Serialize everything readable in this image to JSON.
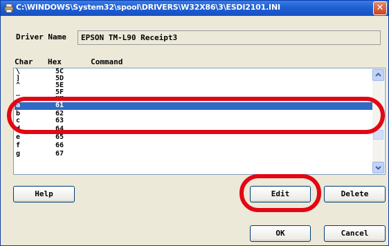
{
  "window": {
    "title": "C:\\WINDOWS\\System32\\spool\\DRIVERS\\W32X86\\3\\ESDI2101.INI",
    "close_glyph": "✕"
  },
  "driver": {
    "label": "Driver Name",
    "value": "EPSON TM-L90 Receipt3"
  },
  "table": {
    "headers": {
      "char": "Char",
      "hex": "Hex",
      "command": "Command"
    },
    "rows": [
      {
        "char": "\\",
        "hex": "5C"
      },
      {
        "char": "]",
        "hex": "5D"
      },
      {
        "char": "^",
        "hex": "5E"
      },
      {
        "char": "_",
        "hex": "5F"
      },
      {
        "char": "`",
        "hex": "60"
      },
      {
        "char": "a",
        "hex": "61"
      },
      {
        "char": "b",
        "hex": "62"
      },
      {
        "char": "c",
        "hex": "63"
      },
      {
        "char": "d",
        "hex": "64"
      },
      {
        "char": "e",
        "hex": "65"
      },
      {
        "char": "f",
        "hex": "66"
      },
      {
        "char": "g",
        "hex": "67"
      }
    ],
    "selected_row": "a"
  },
  "buttons": {
    "help": "Help",
    "edit": "Edit",
    "delete": "Delete",
    "ok": "OK",
    "cancel": "Cancel"
  },
  "icons": {
    "title": "printer-icon",
    "scroll_up": "scroll-up-arrow",
    "scroll_down": "scroll-down-arrow"
  },
  "colors": {
    "title_bar": "#1f5fd1",
    "selection": "#316ac5",
    "annotation": "#e30613",
    "dialog_bg": "#ece9d8"
  }
}
